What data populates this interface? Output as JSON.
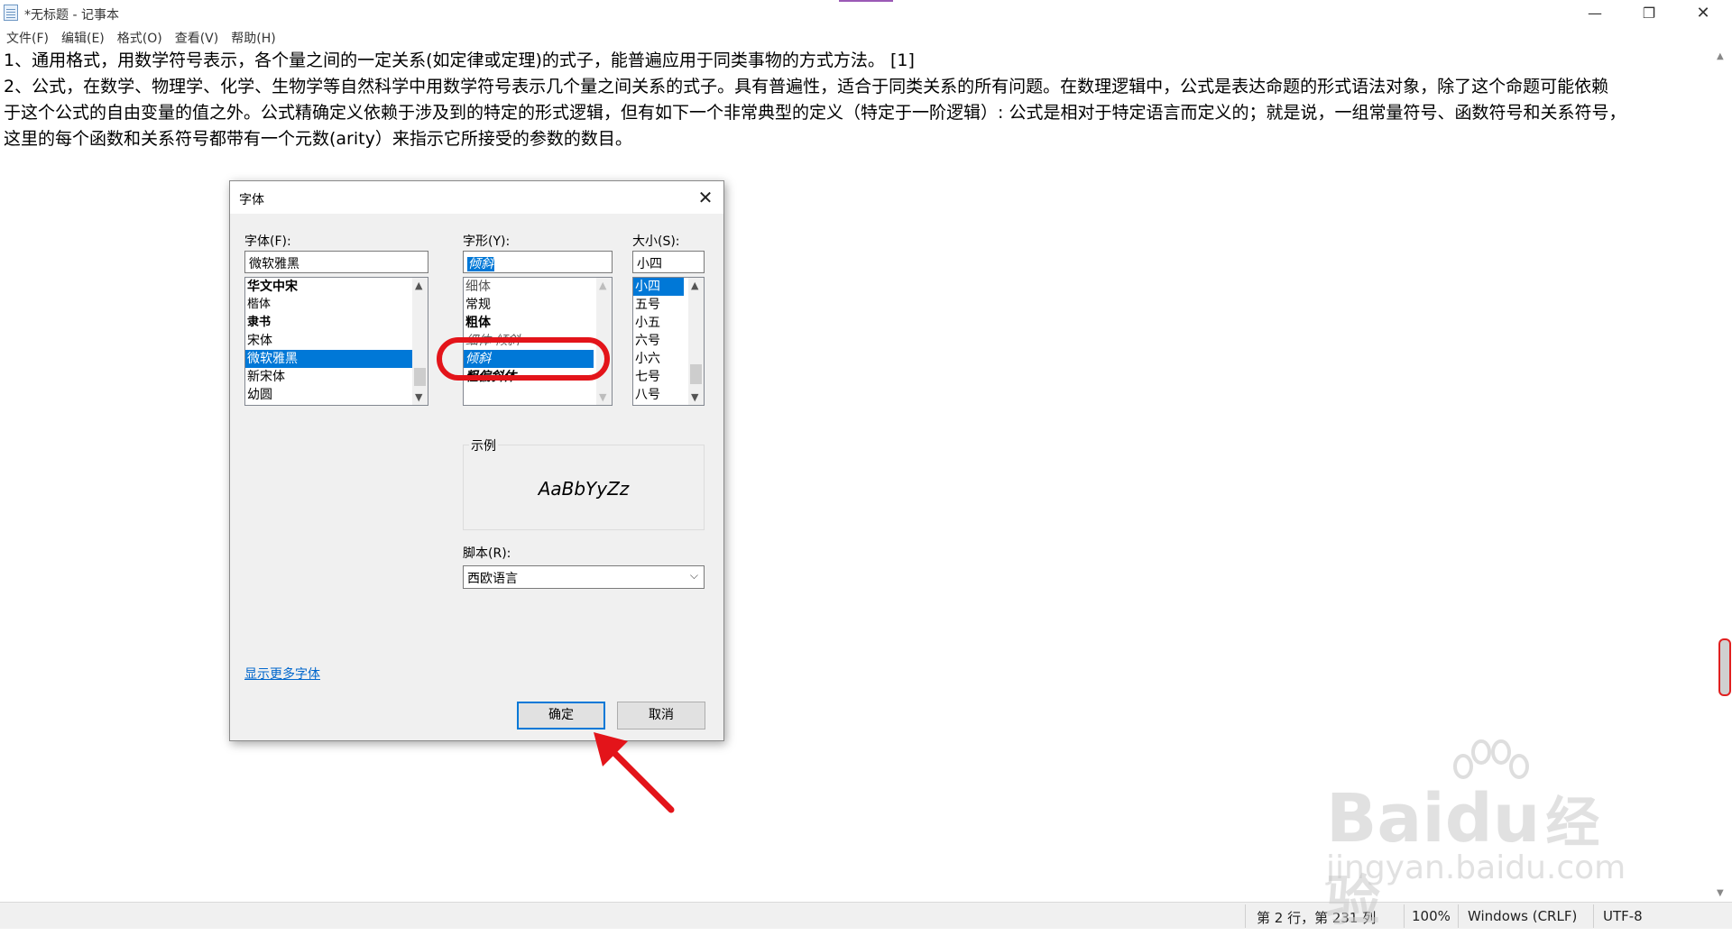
{
  "window": {
    "title": "*无标题 - 记事本",
    "minimize_glyph": "—",
    "maximize_glyph": "❐",
    "close_glyph": "✕"
  },
  "menu": [
    "文件(F)",
    "编辑(E)",
    "格式(O)",
    "查看(V)",
    "帮助(H)"
  ],
  "editor": {
    "lines": [
      "1、通用格式，用数学符号表示，各个量之间的一定关系(如定律或定理)的式子，能普遍应用于同类事物的方式方法。 [1]",
      "2、公式，在数学、物理学、化学、生物学等自然科学中用数学符号表示几个量之间关系的式子。具有普遍性，适合于同类关系的所有问题。在数理逻辑中，公式是表达命题的形式语法对象，除了这个命题可能依赖",
      "于这个公式的自由变量的值之外。公式精确定义依赖于涉及到的特定的形式逻辑，但有如下一个非常典型的定义（特定于一阶逻辑）: 公式是相对于特定语言而定义的；就是说，一组常量符号、函数符号和关系符号，",
      "这里的每个函数和关系符号都带有一个元数(arity）来指示它所接受的参数的数目。"
    ]
  },
  "status": {
    "position": "第 2 行，第 231 列",
    "zoom": "100%",
    "line_ending": "Windows (CRLF)",
    "encoding": "UTF-8"
  },
  "font_dialog": {
    "title": "字体",
    "font_label": "字体(F):",
    "font_value": "微软雅黑",
    "fonts": [
      "华文中宋",
      "楷体",
      "隶书",
      "宋体",
      "微软雅黑",
      "新宋体",
      "幼圆"
    ],
    "selected_font": "微软雅黑",
    "style_label": "字形(Y):",
    "style_value": "倾斜",
    "styles": [
      "细体",
      "常规",
      "粗体",
      "细体 倾斜",
      "倾斜",
      "粗偏斜体"
    ],
    "selected_style": "倾斜",
    "size_label": "大小(S):",
    "size_value": "小四",
    "sizes": [
      "小四",
      "五号",
      "小五",
      "六号",
      "小六",
      "七号",
      "八号"
    ],
    "selected_size": "小四",
    "sample_label": "示例",
    "sample_text": "AaBbYyZz",
    "script_label": "脚本(R):",
    "script_value": "西欧语言",
    "more_fonts_link": "显示更多字体",
    "ok_label": "确定",
    "cancel_label": "取消"
  },
  "watermark": {
    "brand_text": "Bai",
    "brand_text2": "du",
    "brand_text_cn": "经验",
    "url": "jingyan.baidu.com"
  },
  "colors": {
    "selection": "#0078d7",
    "annotation_red": "#e3141a"
  }
}
